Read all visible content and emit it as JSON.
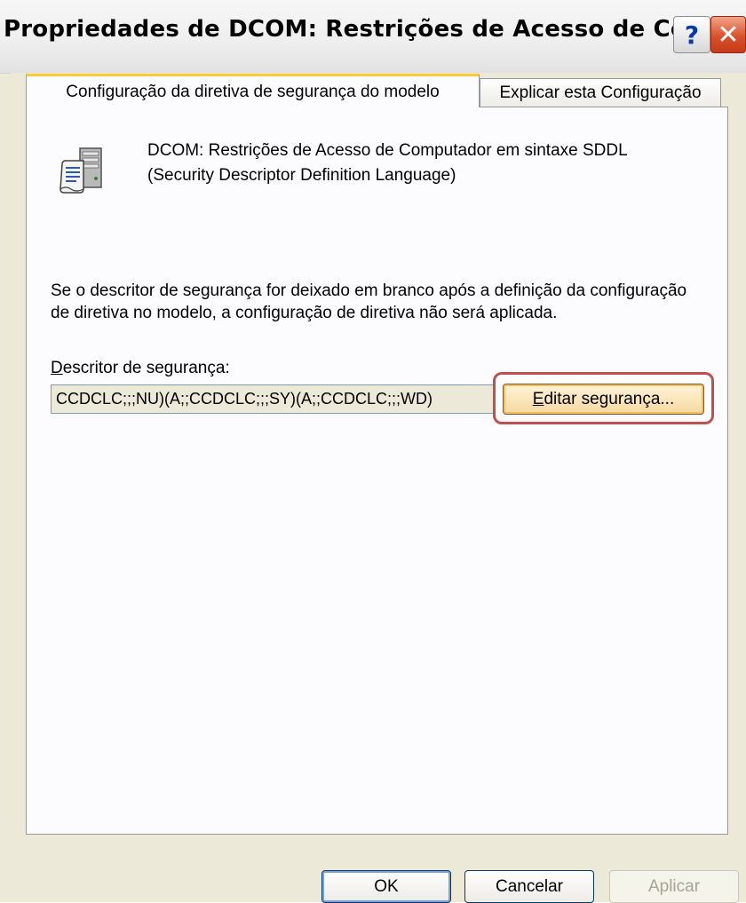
{
  "window": {
    "title": "Propriedades de DCOM: Restrições de Acesso de Comput...",
    "help_glyph": "?",
    "close_glyph": "✕"
  },
  "tabs": [
    {
      "label": "Configuração da diretiva de segurança do modelo",
      "active": true
    },
    {
      "label": "Explicar esta Configuração",
      "active": false
    }
  ],
  "panel": {
    "header_icon": "policy-document-icon",
    "header_line1": "DCOM: Restrições de Acesso de Computador em sintaxe SDDL",
    "header_line2": "(Security Descriptor Definition Language)",
    "description": "Se o descritor de segurança for deixado em branco após a definição da configuração de diretiva no modelo, a configuração de diretiva não será aplicada.",
    "sd_label_mnemonic": "D",
    "sd_label_rest": "escritor de segurança:",
    "sd_value": "CCDCLC;;;NU)(A;;CCDCLC;;;SY)(A;;CCDCLC;;;WD)",
    "edit_button_mnemonic": "E",
    "edit_button_rest": "ditar segurança..."
  },
  "buttons": {
    "ok": "OK",
    "cancel": "Cancelar",
    "apply": "Aplicar"
  },
  "colors": {
    "highlight": "#c0504d",
    "active_tab_accent": "#ffc83c",
    "dialog_bg": "#ece9d8"
  }
}
